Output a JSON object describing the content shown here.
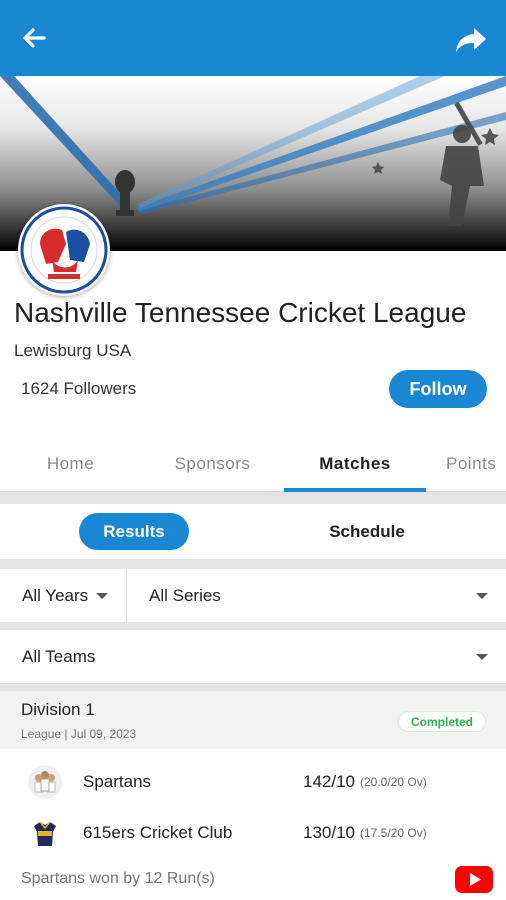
{
  "colors": {
    "primary": "#1a87d2",
    "completed": "#2db34a",
    "youtube": "#ff0000"
  },
  "header": {
    "back_icon": "arrow-left-icon",
    "share_icon": "share-icon"
  },
  "league": {
    "name": "Nashville Tennessee Cricket League",
    "location": "Lewisburg USA",
    "followers": "1624 Followers",
    "follow_label": "Follow"
  },
  "tabs": [
    {
      "label": "Home",
      "active": false
    },
    {
      "label": "Sponsors",
      "active": false
    },
    {
      "label": "Matches",
      "active": true
    },
    {
      "label": "Points",
      "active": false
    }
  ],
  "segments": {
    "results": "Results",
    "schedule": "Schedule",
    "selected": "Results"
  },
  "filters": {
    "years": "All Years",
    "series": "All Series",
    "teams": "All Teams"
  },
  "match": {
    "division": "Division 1",
    "meta": "League | Jul 09, 2023",
    "status": "Completed",
    "teams": [
      {
        "name": "Spartans",
        "score": "142/10",
        "overs": "(20.0/20 Ov)"
      },
      {
        "name": "615ers Cricket Club",
        "score": "130/10",
        "overs": "(17.5/20 Ov)"
      }
    ],
    "result": "Spartans won by 12 Run(s)",
    "video_icon": "youtube-icon"
  }
}
